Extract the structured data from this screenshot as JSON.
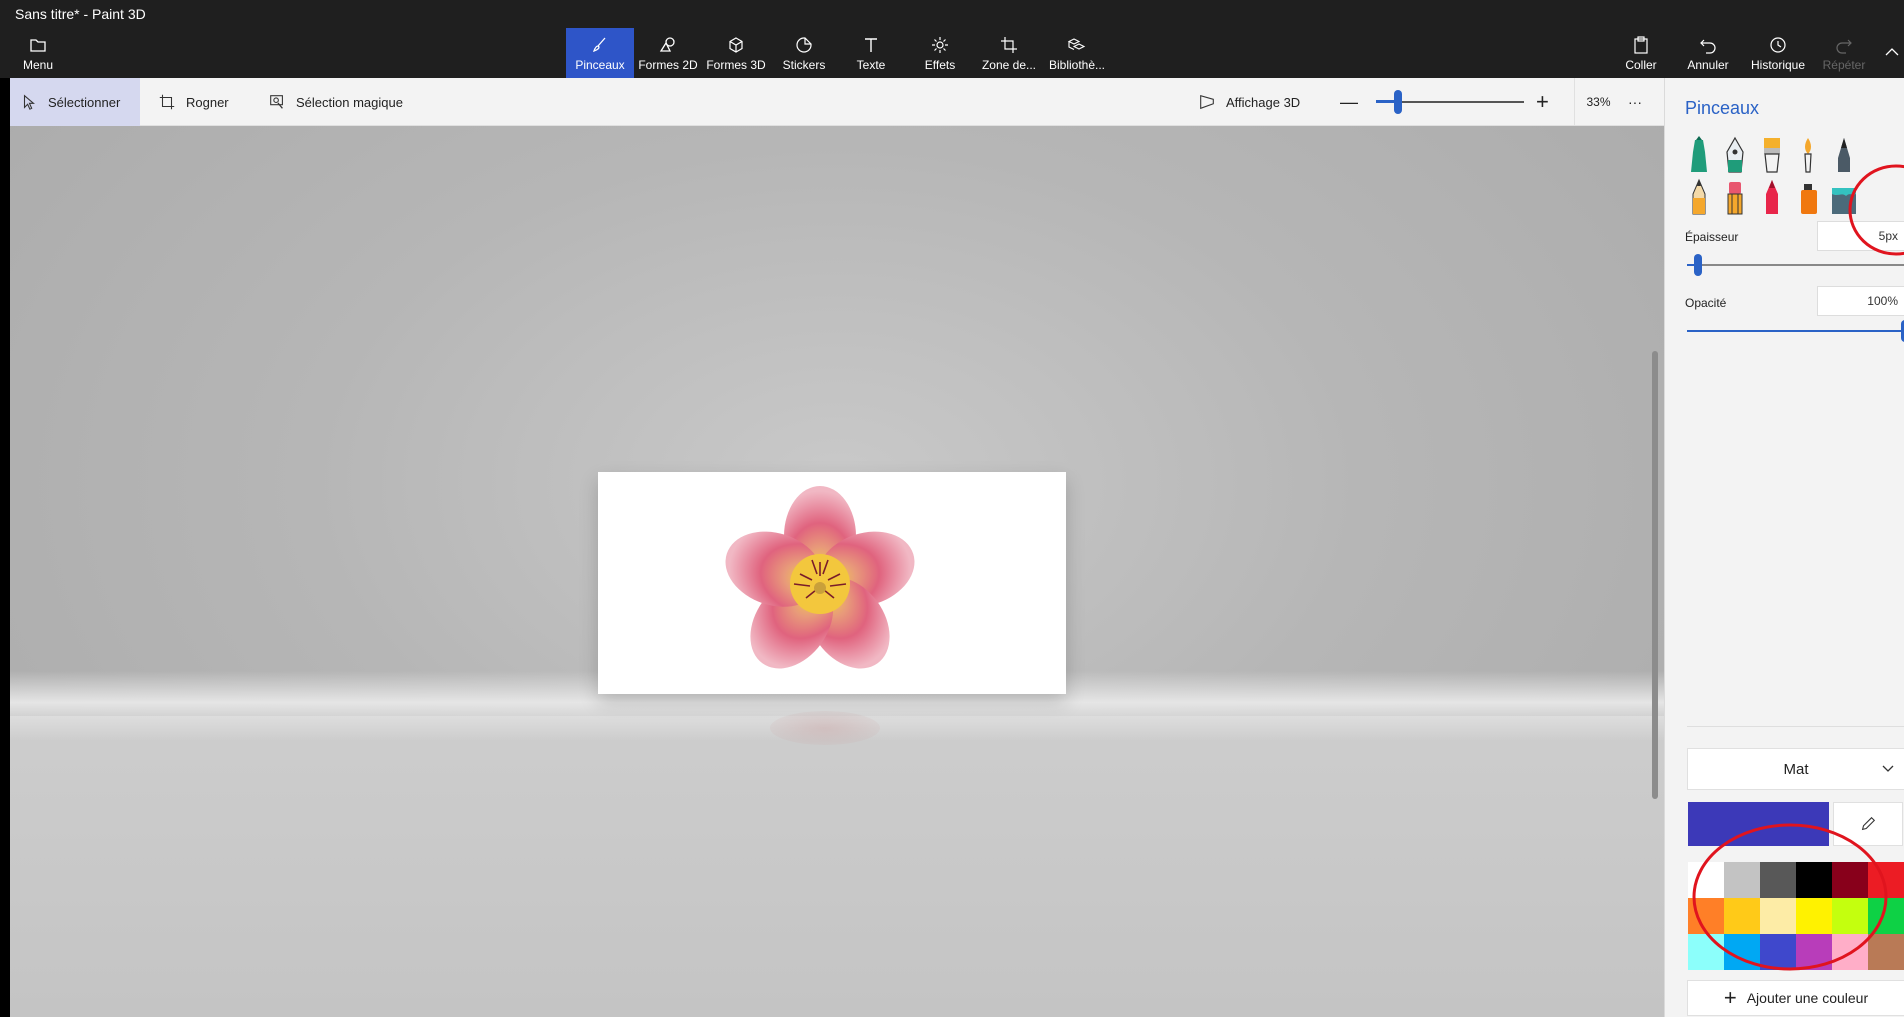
{
  "window": {
    "title": "Sans titre* - Paint 3D"
  },
  "ribbon": {
    "menu": "Menu",
    "tabs": [
      {
        "label": "Pinceaux",
        "icon": "brush-icon",
        "active": true
      },
      {
        "label": "Formes 2D",
        "icon": "shapes-2d-icon"
      },
      {
        "label": "Formes 3D",
        "icon": "cube-icon"
      },
      {
        "label": "Stickers",
        "icon": "sticker-icon"
      },
      {
        "label": "Texte",
        "icon": "text-icon"
      },
      {
        "label": "Effets",
        "icon": "sun-icon"
      },
      {
        "label": "Zone de...",
        "icon": "canvas-crop-icon"
      },
      {
        "label": "Bibliothè...",
        "icon": "library-icon"
      }
    ],
    "right": [
      {
        "label": "Coller",
        "icon": "paste-icon"
      },
      {
        "label": "Annuler",
        "icon": "undo-icon"
      },
      {
        "label": "Historique",
        "icon": "history-icon"
      },
      {
        "label": "Répéter",
        "icon": "redo-icon",
        "disabled": true
      }
    ]
  },
  "toolbar": {
    "select": "Sélectionner",
    "crop": "Rogner",
    "magic_select": "Sélection magique",
    "view3d": "Affichage 3D",
    "zoom_percent": "33%",
    "more": "···",
    "zoom_level": 0.15
  },
  "panel": {
    "title": "Pinceaux",
    "brushes": [
      "marker-icon",
      "calligraphy-pen-icon",
      "oil-brush-icon",
      "watercolor-icon",
      "pixel-pen-icon",
      "pencil-icon",
      "eraser-icon",
      "crayon-icon",
      "spray-can-icon",
      "fill-bucket-icon"
    ],
    "thickness_label": "Épaisseur",
    "thickness_value": "5px",
    "thickness_level": 0.05,
    "opacity_label": "Opacité",
    "opacity_value": "100%",
    "opacity_level": 1.0,
    "finish": "Mat",
    "current_color": "#3c39b8",
    "swatches": [
      "#ffffff",
      "#c3c3c3",
      "#585858",
      "#000000",
      "#88001b",
      "#ec1c24",
      "#ff7f27",
      "#ffca18",
      "#fdeca6",
      "#fff200",
      "#c4ff0e",
      "#0ed145",
      "#8cfffb",
      "#00a8f3",
      "#3f48cc",
      "#b83dba",
      "#ffaec8",
      "#b97a56"
    ],
    "add_color": "Ajouter une couleur"
  },
  "annotation_color": "#e0141e"
}
